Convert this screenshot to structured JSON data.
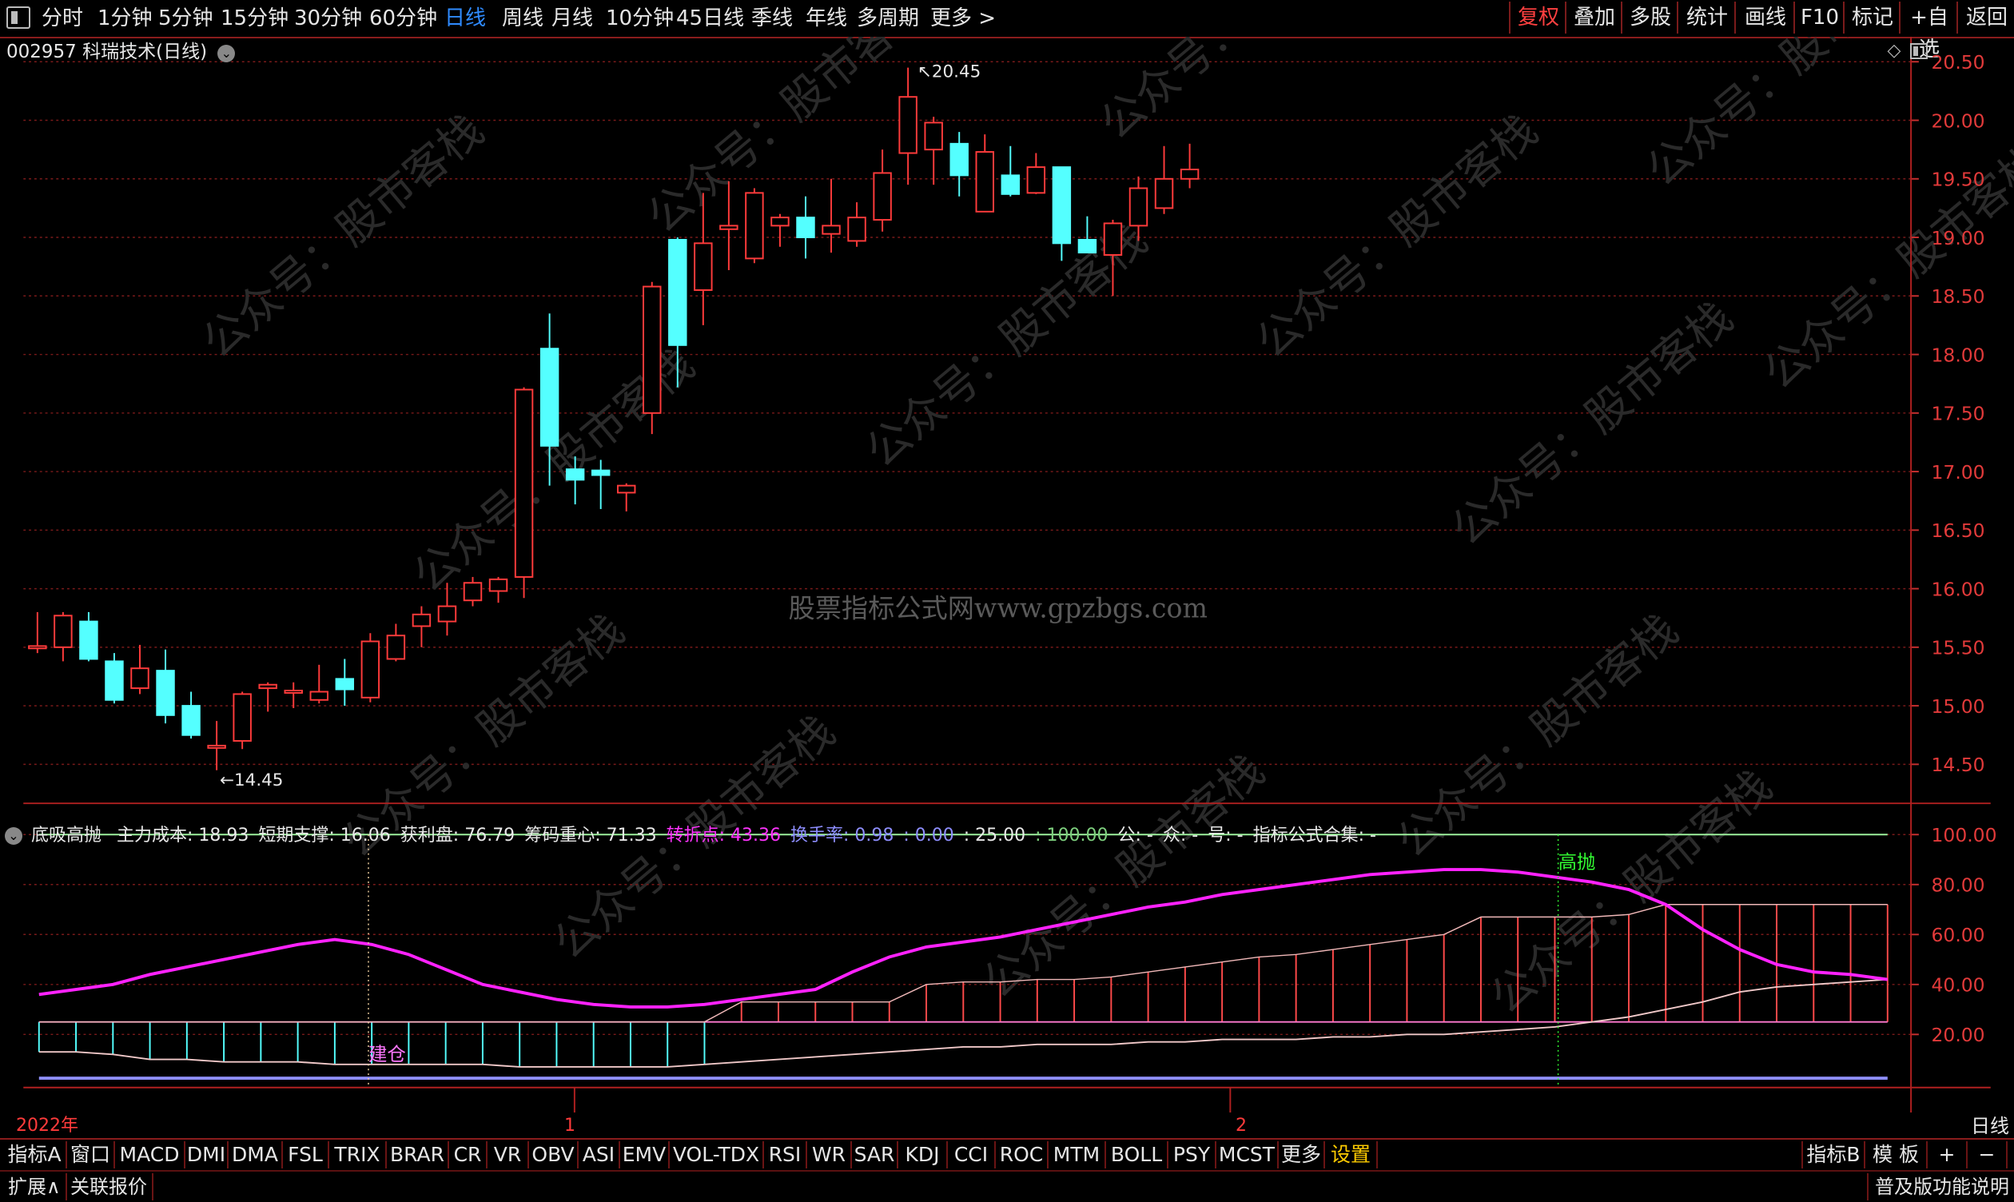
{
  "toolbar": {
    "periods": [
      "分时",
      "1分钟",
      "5分钟",
      "15分钟",
      "30分钟",
      "60分钟",
      "日线",
      "周线",
      "月线",
      "10分钟",
      "45日线",
      "季线",
      "年线",
      "多周期",
      "更多 >"
    ],
    "active_period": "日线",
    "right_buttons": [
      "复权",
      "叠加",
      "多股",
      "统计",
      "画线",
      "F10",
      "标记",
      "+自选",
      "返回"
    ],
    "active_right": "复权"
  },
  "stock": {
    "title": "002957 科瑞技术(日线)"
  },
  "watermark": {
    "center": "股票指标公式网www.gpzbgs.com"
  },
  "price_axis": [
    "20.50",
    "20.00",
    "19.50",
    "19.00",
    "18.50",
    "18.00",
    "17.50",
    "17.00",
    "16.50",
    "16.00",
    "15.50",
    "15.00",
    "14.50"
  ],
  "annotations": {
    "high": "20.45",
    "low": "14.45"
  },
  "candles": [
    {
      "o": 15.5,
      "c": 15.5,
      "h": 15.8,
      "l": 15.45
    },
    {
      "o": 15.5,
      "c": 15.77,
      "h": 15.8,
      "l": 15.38
    },
    {
      "o": 15.72,
      "c": 15.4,
      "h": 15.8,
      "l": 15.38
    },
    {
      "o": 15.38,
      "c": 15.05,
      "h": 15.45,
      "l": 15.02
    },
    {
      "o": 15.15,
      "c": 15.32,
      "h": 15.52,
      "l": 15.1
    },
    {
      "o": 15.3,
      "c": 14.92,
      "h": 15.48,
      "l": 14.85
    },
    {
      "o": 15.0,
      "c": 14.75,
      "h": 15.12,
      "l": 14.72
    },
    {
      "o": 14.65,
      "c": 14.65,
      "h": 14.87,
      "l": 14.45
    },
    {
      "o": 14.7,
      "c": 15.1,
      "h": 15.12,
      "l": 14.63
    },
    {
      "o": 15.15,
      "c": 15.18,
      "h": 15.2,
      "l": 14.95
    },
    {
      "o": 15.12,
      "c": 15.12,
      "h": 15.2,
      "l": 14.98
    },
    {
      "o": 15.05,
      "c": 15.12,
      "h": 15.35,
      "l": 15.02
    },
    {
      "o": 15.23,
      "c": 15.14,
      "h": 15.4,
      "l": 15.0
    },
    {
      "o": 15.07,
      "c": 15.55,
      "h": 15.62,
      "l": 15.03
    },
    {
      "o": 15.4,
      "c": 15.6,
      "h": 15.7,
      "l": 15.38
    },
    {
      "o": 15.68,
      "c": 15.78,
      "h": 15.85,
      "l": 15.5
    },
    {
      "o": 15.72,
      "c": 15.85,
      "h": 16.05,
      "l": 15.6
    },
    {
      "o": 15.9,
      "c": 16.05,
      "h": 16.1,
      "l": 15.85
    },
    {
      "o": 15.98,
      "c": 16.08,
      "h": 16.1,
      "l": 15.88
    },
    {
      "o": 16.1,
      "c": 17.7,
      "h": 17.72,
      "l": 15.92
    },
    {
      "o": 18.05,
      "c": 17.22,
      "h": 18.35,
      "l": 16.88
    },
    {
      "o": 17.02,
      "c": 16.93,
      "h": 17.13,
      "l": 16.72
    },
    {
      "o": 17.0,
      "c": 16.98,
      "h": 17.1,
      "l": 16.68
    },
    {
      "o": 16.82,
      "c": 16.88,
      "h": 16.9,
      "l": 16.66
    },
    {
      "o": 17.5,
      "c": 18.58,
      "h": 18.62,
      "l": 17.32
    },
    {
      "o": 18.98,
      "c": 18.08,
      "h": 19.0,
      "l": 17.72
    },
    {
      "o": 18.55,
      "c": 18.95,
      "h": 19.38,
      "l": 18.25
    },
    {
      "o": 19.07,
      "c": 19.1,
      "h": 19.48,
      "l": 18.72
    },
    {
      "o": 18.82,
      "c": 19.38,
      "h": 19.42,
      "l": 18.78
    },
    {
      "o": 19.1,
      "c": 19.17,
      "h": 19.2,
      "l": 18.92
    },
    {
      "o": 19.17,
      "c": 19.0,
      "h": 19.35,
      "l": 18.82
    },
    {
      "o": 19.03,
      "c": 19.1,
      "h": 19.5,
      "l": 18.87
    },
    {
      "o": 18.97,
      "c": 19.17,
      "h": 19.3,
      "l": 18.92
    },
    {
      "o": 19.15,
      "c": 19.55,
      "h": 19.75,
      "l": 19.05
    },
    {
      "o": 19.72,
      "c": 20.2,
      "h": 20.45,
      "l": 19.45
    },
    {
      "o": 19.75,
      "c": 19.98,
      "h": 20.03,
      "l": 19.45
    },
    {
      "o": 19.8,
      "c": 19.53,
      "h": 19.9,
      "l": 19.35
    },
    {
      "o": 19.22,
      "c": 19.73,
      "h": 19.88,
      "l": 19.22
    },
    {
      "o": 19.53,
      "c": 19.37,
      "h": 19.78,
      "l": 19.35
    },
    {
      "o": 19.38,
      "c": 19.6,
      "h": 19.72,
      "l": 19.37
    },
    {
      "o": 19.6,
      "c": 18.95,
      "h": 19.6,
      "l": 18.8
    },
    {
      "o": 18.98,
      "c": 18.87,
      "h": 19.18,
      "l": 18.87
    },
    {
      "o": 18.85,
      "c": 19.12,
      "h": 19.15,
      "l": 18.5
    },
    {
      "o": 19.1,
      "c": 19.42,
      "h": 19.52,
      "l": 18.97
    },
    {
      "o": 19.25,
      "c": 19.5,
      "h": 19.78,
      "l": 19.2
    },
    {
      "o": 19.5,
      "c": 19.58,
      "h": 19.8,
      "l": 19.42
    }
  ],
  "indicator": {
    "name": "底吸高抛",
    "legend": [
      {
        "text": "主力成本: 18.93",
        "color": "#e8e8e8"
      },
      {
        "text": "短期支撑: 16.06",
        "color": "#e8e8e8"
      },
      {
        "text": "获利盘: 76.79",
        "color": "#e8e8e8"
      },
      {
        "text": "筹码重心: 71.33",
        "color": "#e8e8e8"
      },
      {
        "text": "转折点: 43.36",
        "color": "#ff33ff"
      },
      {
        "text": "换手率: 0.98",
        "color": "#8e8eff"
      },
      {
        "text": ": 0.00",
        "color": "#8e8eff"
      },
      {
        "text": ": 25.00",
        "color": "#e8e8e8"
      },
      {
        "text": ": 100.00",
        "color": "#7ed07e"
      },
      {
        "text": "公: -",
        "color": "#e8e8e8"
      },
      {
        "text": "众: -",
        "color": "#e8e8e8"
      },
      {
        "text": "号: -",
        "color": "#e8e8e8"
      },
      {
        "text": "指标公式合集: -",
        "color": "#e8e8e8"
      }
    ],
    "axis": [
      "100.00",
      "80.00",
      "60.00",
      "40.00",
      "20.00"
    ],
    "label_buy": "建仓",
    "label_sell": "高抛",
    "magenta_line": [
      36,
      38,
      40,
      44,
      47,
      50,
      53,
      56,
      58,
      56,
      52,
      46,
      40,
      37,
      34,
      32,
      31,
      31,
      32,
      34,
      36,
      38,
      45,
      51,
      55,
      57,
      59,
      62,
      65,
      68,
      71,
      73,
      76,
      78,
      80,
      82,
      84,
      85,
      86,
      86,
      85,
      83,
      81,
      78,
      72,
      62,
      54,
      48,
      45,
      44,
      42
    ],
    "white_line": [
      13,
      13,
      12,
      10,
      10,
      9,
      9,
      9,
      8,
      8,
      8,
      8,
      8,
      7,
      7,
      7,
      7,
      7,
      8,
      9,
      10,
      11,
      12,
      13,
      14,
      15,
      15,
      16,
      16,
      16,
      17,
      17,
      18,
      18,
      18,
      19,
      19,
      20,
      20,
      21,
      22,
      23,
      25,
      27,
      30,
      33,
      37,
      39,
      40,
      41,
      42
    ],
    "bar_values": [
      25,
      25,
      25,
      25,
      25,
      25,
      25,
      25,
      25,
      25,
      25,
      25,
      25,
      25,
      25,
      25,
      25,
      25,
      25,
      33,
      33,
      33,
      33,
      33,
      40,
      41,
      41,
      42,
      42,
      43,
      45,
      47,
      49,
      51,
      52,
      54,
      56,
      58,
      60,
      67,
      67,
      67,
      67,
      68,
      72,
      72,
      72,
      72,
      72,
      72,
      72
    ],
    "upper_level": 100,
    "lower_level": 25
  },
  "time_axis": {
    "year": "2022年",
    "m1": "1",
    "m2": "2",
    "right": "日线"
  },
  "footer": {
    "tabs": [
      "指标A",
      "窗口",
      "MACD",
      "DMI",
      "DMA",
      "FSL",
      "TRIX",
      "BRAR",
      "CR",
      "VR",
      "OBV",
      "ASI",
      "EMV",
      "VOL-TDX",
      "RSI",
      "WR",
      "SAR",
      "KDJ",
      "CCI",
      "ROC",
      "MTM",
      "BOLL",
      "PSY",
      "MCST",
      "更多",
      "设置"
    ],
    "active_tab": "设置",
    "right": [
      "指标B",
      "模 板",
      "+",
      "−"
    ],
    "row2_left": [
      "扩展∧",
      "关联报价"
    ],
    "row2_right": "普及版功能说明"
  }
}
